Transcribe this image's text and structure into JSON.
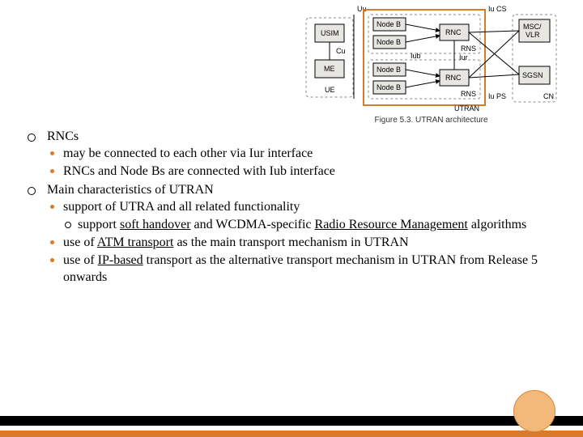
{
  "diagram": {
    "caption": "Figure 5.3.   UTRAN architecture",
    "labels": {
      "uu": "Uu",
      "iu_cs": "Iu CS",
      "iu_ps": "Iu PS",
      "cu": "Cu",
      "iub": "Iub",
      "iur": "Iur",
      "ue": "UE",
      "utran": "UTRAN",
      "cn": "CN",
      "usim": "USIM",
      "me": "ME",
      "nodeb": "Node B",
      "rnc": "RNC",
      "rns": "RNS",
      "msc_vlr": "MSC/\nVLR",
      "sgsn": "SGSN"
    }
  },
  "bullets": {
    "b1": "RNCs",
    "b1_1": "may be connected to each other via Iur interface",
    "b1_2": "RNCs and Node Bs are connected with Iub interface",
    "b2": "Main characteristics of UTRAN",
    "b2_1": "support of UTRA and all related functionality",
    "b2_1_1_pre": "support ",
    "b2_1_1_u1": "soft handover",
    "b2_1_1_mid": " and WCDMA-specific ",
    "b2_1_1_u2": "Radio Resource Management",
    "b2_1_1_post": " algorithms",
    "b2_2_pre": "use of ",
    "b2_2_u": "ATM transport",
    "b2_2_post": " as the main transport mechanism in UTRAN",
    "b2_3_pre": "use of ",
    "b2_3_u": "IP-based",
    "b2_3_post": " transport as the alternative transport mechanism in UTRAN from Release 5 onwards"
  }
}
